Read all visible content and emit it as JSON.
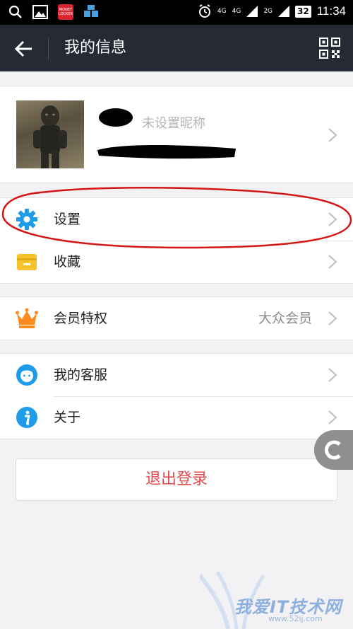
{
  "status_bar": {
    "battery": "32",
    "time": "11:34",
    "network_1": "4G",
    "network_2": "4G",
    "network_3": "2G",
    "app_icons": [
      "search-icon",
      "gallery-icon",
      "money-locker-icon",
      "app-icon"
    ],
    "money_locker_label": "MONEY LOCKER"
  },
  "header": {
    "title": "我的信息",
    "back_icon": "arrow-left-icon",
    "qr_icon": "qr-code-icon"
  },
  "profile": {
    "nickname_placeholder": "未设置昵称"
  },
  "groups": [
    {
      "rows": [
        {
          "icon": "gear-icon",
          "label": "设置",
          "value": ""
        },
        {
          "icon": "folder-icon",
          "label": "收藏",
          "value": ""
        }
      ]
    },
    {
      "rows": [
        {
          "icon": "crown-icon",
          "label": "会员特权",
          "value": "大众会员"
        }
      ]
    },
    {
      "rows": [
        {
          "icon": "customer-service-icon",
          "label": "我的客服",
          "value": ""
        },
        {
          "icon": "info-icon",
          "label": "关于",
          "value": ""
        }
      ]
    }
  ],
  "logout_label": "退出登录",
  "watermark": {
    "text": "我爱IT技术网",
    "url": "www.52ij.com"
  },
  "colors": {
    "header_bg": "#252a35",
    "accent_blue": "#1e9be9",
    "logout_red": "#e64b4b",
    "crown_orange": "#ff8a1d",
    "folder_yellow": "#f7c22a",
    "annotation_red": "#d41616"
  }
}
